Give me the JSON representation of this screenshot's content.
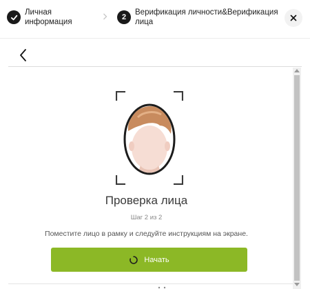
{
  "stepper": {
    "steps": [
      {
        "label": "Личная информация",
        "state": "done",
        "icon": "check-icon"
      },
      {
        "number": "2",
        "label": "Верификация личности&Верификация лица",
        "state": "active"
      }
    ],
    "separator_icon": "chevron-right-icon",
    "close_icon": "close-icon"
  },
  "nav": {
    "back_icon": "chevron-left-icon"
  },
  "verification": {
    "title": "Проверка лица",
    "step_counter": "Шаг 2 из 2",
    "instruction": "Поместите лицо в рамку и следуйте инструкциям на экране.",
    "start_button_label": "Начать",
    "start_button_icon": "spinner-icon"
  },
  "colors": {
    "accent": "#8cb826",
    "step_circle": "#1a1a1a"
  }
}
